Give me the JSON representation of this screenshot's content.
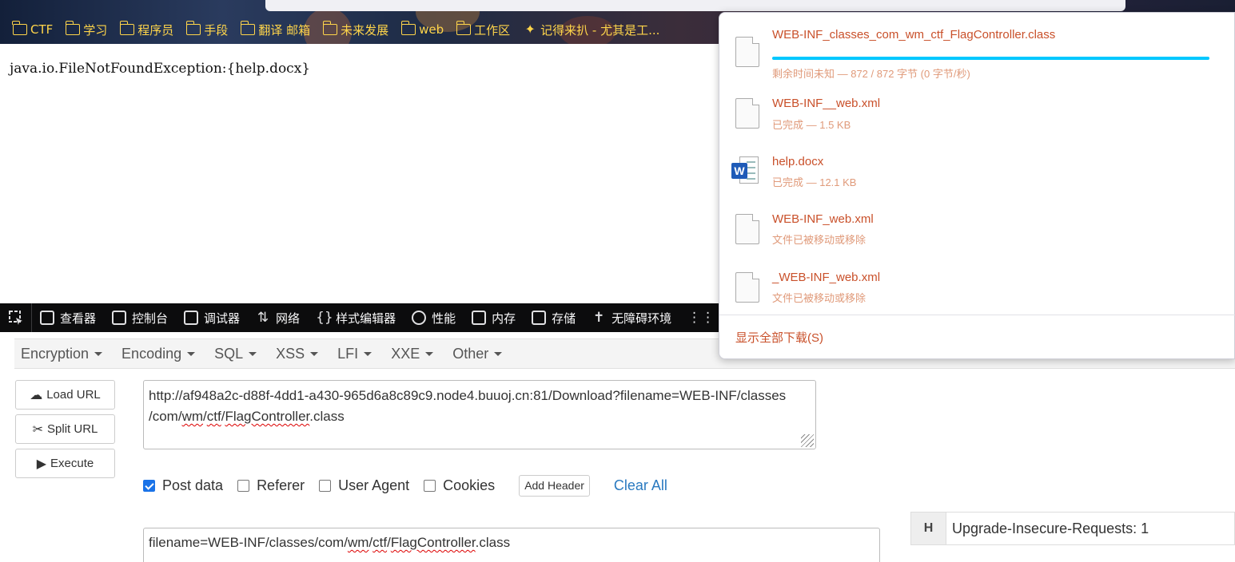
{
  "bookmarks": [
    {
      "label": "CTF",
      "icon": "folder-icon"
    },
    {
      "label": "学习",
      "icon": "folder-icon"
    },
    {
      "label": "程序员",
      "icon": "folder-icon"
    },
    {
      "label": "手段",
      "icon": "folder-icon"
    },
    {
      "label": "翻译 邮箱",
      "icon": "folder-icon"
    },
    {
      "label": "未来发展",
      "icon": "folder-icon"
    },
    {
      "label": "web",
      "icon": "folder-icon"
    },
    {
      "label": "工作区",
      "icon": "folder-icon"
    },
    {
      "label": "记得来扒 - 尤其是工...",
      "icon": "site-icon"
    }
  ],
  "page": {
    "error_text": "java.io.FileNotFoundException:{help.docx}"
  },
  "devtools": {
    "tabs": [
      {
        "label": "查看器",
        "icon": "inspector-icon"
      },
      {
        "label": "控制台",
        "icon": "console-icon"
      },
      {
        "label": "调试器",
        "icon": "debugger-icon"
      },
      {
        "label": "网络",
        "icon": "network-icon"
      },
      {
        "label": "样式编辑器",
        "icon": "style-editor-icon"
      },
      {
        "label": "性能",
        "icon": "performance-icon"
      },
      {
        "label": "内存",
        "icon": "memory-icon"
      },
      {
        "label": "存储",
        "icon": "storage-icon"
      },
      {
        "label": "无障碍环境",
        "icon": "accessibility-icon"
      }
    ]
  },
  "hackbar": {
    "menu": [
      "Encryption",
      "Encoding",
      "SQL",
      "XSS",
      "LFI",
      "XXE",
      "Other"
    ],
    "buttons": {
      "load": "Load URL",
      "split": "Split URL",
      "execute": "Execute"
    },
    "url_line1": "http://af948a2c-d88f-4dd1-a430-965d6a8c89c9.node4.buuoj.cn:81/Download?filename=WEB-INF/classes",
    "url_line2_pre": "/com/",
    "url_line2_wm": "wm",
    "url_line2_slash1": "/",
    "url_line2_ctf": "ctf",
    "url_line2_slash2": "/",
    "url_line2_flag": "FlagController",
    "url_line2_post": ".class",
    "checkboxes": [
      {
        "label": "Post data",
        "checked": true
      },
      {
        "label": "Referer",
        "checked": false
      },
      {
        "label": "User Agent",
        "checked": false
      },
      {
        "label": "Cookies",
        "checked": false
      }
    ],
    "add_header": "Add Header",
    "clear_all": "Clear All",
    "post_pre": "filename=WEB-INF/classes/com/",
    "post_wm": "wm",
    "post_slash1": "/",
    "post_ctf": "ctf",
    "post_slash2": "/",
    "post_flag": "FlagController",
    "post_post": ".class",
    "header_badge": "H",
    "header_value": "Upgrade-Insecure-Requests: 1"
  },
  "downloads": {
    "items": [
      {
        "name": "WEB-INF_classes_com_wm_ctf_FlagController.class",
        "status": "剩余时间未知 — 872 / 872 字节 (0 字节/秒)",
        "progress": 1.0,
        "icon": "file-icon"
      },
      {
        "name": "WEB-INF__web.xml",
        "status": "已完成 — 1.5 KB",
        "icon": "file-icon"
      },
      {
        "name": "help.docx",
        "status": "已完成 — 12.1 KB",
        "icon": "word-file-icon"
      },
      {
        "name": "WEB-INF_web.xml",
        "status": "文件已被移动或移除",
        "icon": "file-icon"
      },
      {
        "name": "_WEB-INF_web.xml",
        "status": "文件已被移动或移除",
        "icon": "file-icon"
      }
    ],
    "footer": "显示全部下载(S)"
  }
}
